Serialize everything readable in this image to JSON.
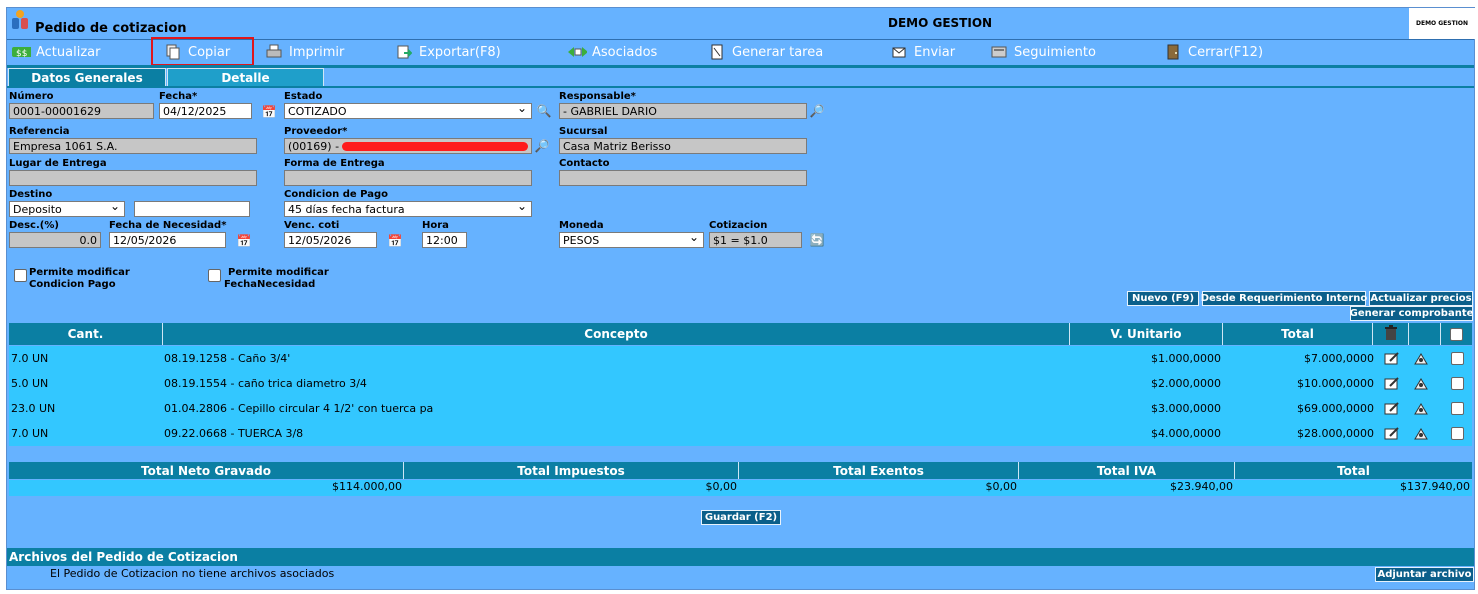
{
  "header": {
    "title": "Pedido de cotizacion",
    "company": "DEMO GESTION",
    "brand_logo_text": "DEMO GESTION"
  },
  "toolbar": [
    {
      "id": "actualizar",
      "label": "Actualizar",
      "icon": "refresh-money-icon"
    },
    {
      "id": "copiar",
      "label": "Copiar",
      "icon": "copy-icon"
    },
    {
      "id": "imprimir",
      "label": "Imprimir",
      "icon": "printer-icon"
    },
    {
      "id": "exportar",
      "label": "Exportar(F8)",
      "icon": "export-icon"
    },
    {
      "id": "asociados",
      "label": "Asociados",
      "icon": "associated-icon"
    },
    {
      "id": "generar_tarea",
      "label": "Generar tarea",
      "icon": "task-icon"
    },
    {
      "id": "enviar",
      "label": "Enviar",
      "icon": "send-icon"
    },
    {
      "id": "seguimiento",
      "label": "Seguimiento",
      "icon": "tracking-icon"
    },
    {
      "id": "cerrar",
      "label": "Cerrar(F12)",
      "icon": "close-door-icon"
    }
  ],
  "tabs": [
    {
      "label": "Datos Generales",
      "active": true
    },
    {
      "label": "Detalle",
      "active": false
    }
  ],
  "form": {
    "numero": {
      "label": "Número",
      "value": "0001-00001629"
    },
    "fecha": {
      "label": "Fecha*",
      "value": "04/12/2025"
    },
    "estado": {
      "label": "Estado",
      "value": "COTIZADO"
    },
    "responsable": {
      "label": "Responsable*",
      "value": "- GABRIEL DARIO"
    },
    "referencia": {
      "label": "Referencia",
      "value": "Empresa 1061 S.A."
    },
    "proveedor": {
      "label": "Proveedor*",
      "value": "(00169) -"
    },
    "sucursal": {
      "label": "Sucursal",
      "value": "Casa Matriz Berisso"
    },
    "lugar_entrega": {
      "label": "Lugar de Entrega",
      "value": ""
    },
    "forma_entrega": {
      "label": "Forma de Entrega",
      "value": ""
    },
    "contacto": {
      "label": "Contacto",
      "value": ""
    },
    "destino": {
      "label": "Destino",
      "value": "Deposito",
      "extra": ""
    },
    "condicion_pago": {
      "label": "Condicion de Pago",
      "value": "45 días fecha factura"
    },
    "descuento": {
      "label": "Desc.(%)",
      "value": "0.0"
    },
    "fecha_necesidad": {
      "label": "Fecha de Necesidad*",
      "value": "12/05/2026"
    },
    "venc_coti": {
      "label": "Venc. coti",
      "value": "12/05/2026"
    },
    "hora": {
      "label": "Hora",
      "value": "12:00"
    },
    "moneda": {
      "label": "Moneda",
      "value": "PESOS"
    },
    "cotizacion": {
      "label": "Cotizacion",
      "value": "$1 = $1.0"
    },
    "permite_condicion": {
      "line1": "Permite modificar",
      "line2": "Condicion Pago",
      "checked": false
    },
    "permite_fecha": {
      "line1": "Permite modificar",
      "line2": "FechaNecesidad",
      "checked": false
    }
  },
  "actions": {
    "nuevo": "Nuevo (F9)",
    "desde_requerimiento": "Desde Requerimiento Interno",
    "actualizar_precios": "Actualizar precios",
    "generar_comprobante": "Generar comprobante"
  },
  "items_table": {
    "columns": [
      "Cant.",
      "Concepto",
      "V. Unitario",
      "Total"
    ],
    "rows": [
      {
        "cant": "7.0 UN",
        "concepto": "08.19.1258 - Caño 3/4'",
        "unitario": "$1.000,0000",
        "total": "$7.000,0000"
      },
      {
        "cant": "5.0 UN",
        "concepto": "08.19.1554 - caño trica diametro 3/4",
        "unitario": "$2.000,0000",
        "total": "$10.000,0000"
      },
      {
        "cant": "23.0 UN",
        "concepto": "01.04.2806 - Cepillo circular 4 1/2' con tuerca pa",
        "unitario": "$3.000,0000",
        "total": "$69.000,0000"
      },
      {
        "cant": "7.0 UN",
        "concepto": "09.22.0668 - TUERCA 3/8",
        "unitario": "$4.000,0000",
        "total": "$28.000,0000"
      }
    ]
  },
  "totals": {
    "headers": [
      "Total Neto Gravado",
      "Total Impuestos",
      "Total Exentos",
      "Total IVA",
      "Total"
    ],
    "values": [
      "$114.000,00",
      "$0,00",
      "$0,00",
      "$23.940,00",
      "$137.940,00"
    ]
  },
  "guardar": "Guardar (F2)",
  "archivos": {
    "title": "Archivos del Pedido de Cotizacion",
    "empty_message": "El Pedido de Cotizacion no tiene archivos asociados",
    "adjuntar": "Adjuntar archivo"
  },
  "colors": {
    "panel_bg": "#66b2ff",
    "header_teal": "#0b7fa3",
    "row_cyan": "#33c7ff",
    "button_navy": "#0b5f8a",
    "highlight_red": "#e0161b"
  }
}
